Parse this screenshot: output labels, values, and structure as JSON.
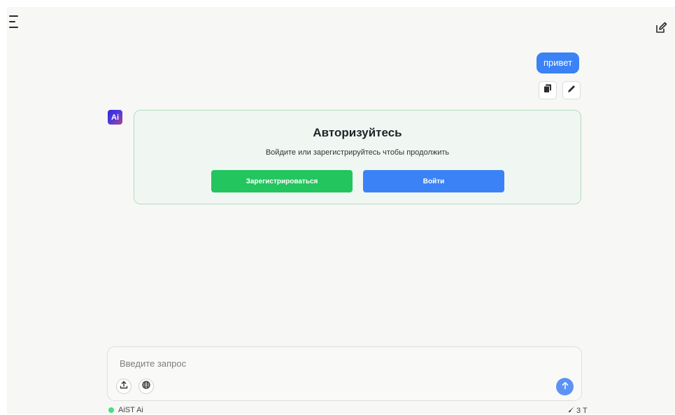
{
  "chat": {
    "user_message": "привет"
  },
  "auth": {
    "avatar_label": "Ai",
    "title": "Авторизуйтесь",
    "subtitle": "Войдите или зарегистрируйтесь чтобы продолжить",
    "register_label": "Зарегистрироваться",
    "login_label": "Войти"
  },
  "composer": {
    "placeholder": "Введите запрос",
    "value": ""
  },
  "footer": {
    "model_name": "AiST Ai",
    "token_count": "3 T"
  },
  "icons": {
    "menu": "menu-icon",
    "new_chat": "edit-icon",
    "copy": "copy-icon",
    "edit": "pencil-icon",
    "upload": "upload-icon",
    "web": "globe-icon",
    "send": "arrow-up-icon",
    "tokens": "brush-icon"
  },
  "colors": {
    "accent_blue": "#3b82f6",
    "accent_green": "#22c55e",
    "status_green": "#4ade80",
    "card_bg": "#f0f7f2",
    "card_border": "#b4dcbf"
  }
}
